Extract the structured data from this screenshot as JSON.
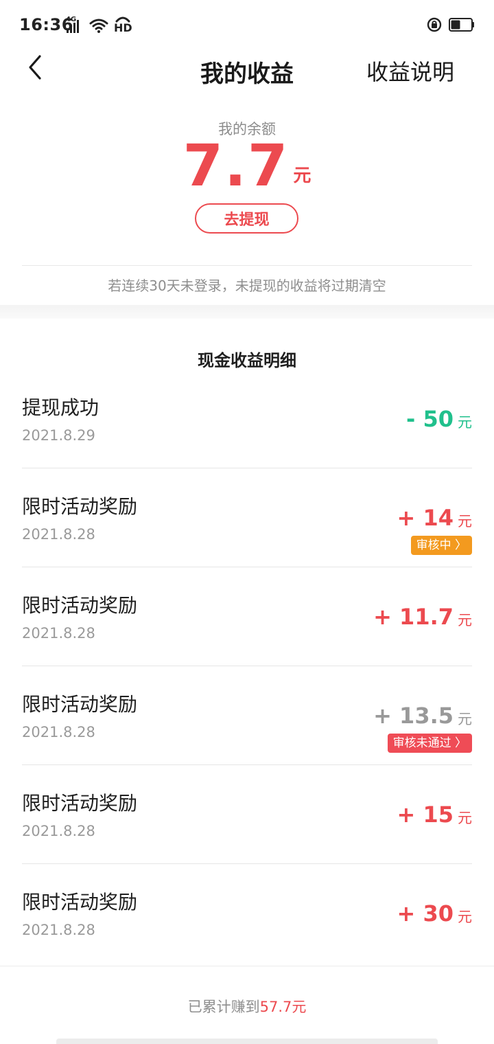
{
  "status_bar": {
    "time": "16:36",
    "network": "4G",
    "hd": "HD"
  },
  "nav": {
    "title": "我的收益",
    "help": "收益说明"
  },
  "balance": {
    "label": "我的余额",
    "value": "7.7",
    "unit": "元",
    "withdraw_label": "去提现"
  },
  "notice": "若连续30天未登录，未提现的收益将过期清空",
  "section_title": "现金收益明细",
  "records": [
    {
      "title": "提现成功",
      "date": "2021.8.29",
      "amount": "- 50",
      "unit": "元",
      "amount_color": "#20c08c",
      "badge": "",
      "badge_color": ""
    },
    {
      "title": "限时活动奖励",
      "date": "2021.8.28",
      "amount": "+ 14",
      "unit": "元",
      "amount_color": "#ec4a4f",
      "badge": "审核中 〉",
      "badge_color": "#f39a1f"
    },
    {
      "title": "限时活动奖励",
      "date": "2021.8.28",
      "amount": "+ 11.7",
      "unit": "元",
      "amount_color": "#ec4a4f",
      "badge": "",
      "badge_color": ""
    },
    {
      "title": "限时活动奖励",
      "date": "2021.8.28",
      "amount": "+ 13.5",
      "unit": "元",
      "amount_color": "#999999",
      "badge": "审核未通过 〉",
      "badge_color": "#ef4c56"
    },
    {
      "title": "限时活动奖励",
      "date": "2021.8.28",
      "amount": "+ 15",
      "unit": "元",
      "amount_color": "#ec4a4f",
      "badge": "",
      "badge_color": ""
    },
    {
      "title": "限时活动奖励",
      "date": "2021.8.28",
      "amount": "+ 30",
      "unit": "元",
      "amount_color": "#ec4a4f",
      "badge": "",
      "badge_color": ""
    }
  ],
  "footer": {
    "prefix": "已累计赚到",
    "amount": "57.7元"
  }
}
